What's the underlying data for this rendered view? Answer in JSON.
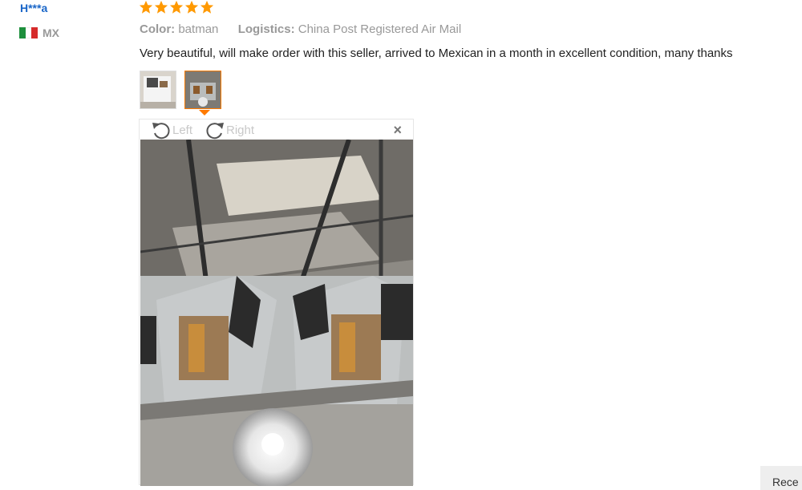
{
  "reviewer": {
    "name": "H***a",
    "country_code": "MX",
    "flag_colors": [
      "#1d8f3c",
      "#ffffff",
      "#d62b2b"
    ]
  },
  "review": {
    "rating": 5,
    "star_color": "#ff9900",
    "color_label": "Color:",
    "color_value": "batman",
    "logistics_label": "Logistics:",
    "logistics_value": "China Post Registered Air Mail",
    "text": "Very beautiful, will make order with this seller, arrived to Mexican in a month in excellent condition, many thanks"
  },
  "viewer": {
    "rotate_left_label": "Left",
    "rotate_right_label": "Right",
    "close_label": "×"
  },
  "side_button_label": "Rece"
}
